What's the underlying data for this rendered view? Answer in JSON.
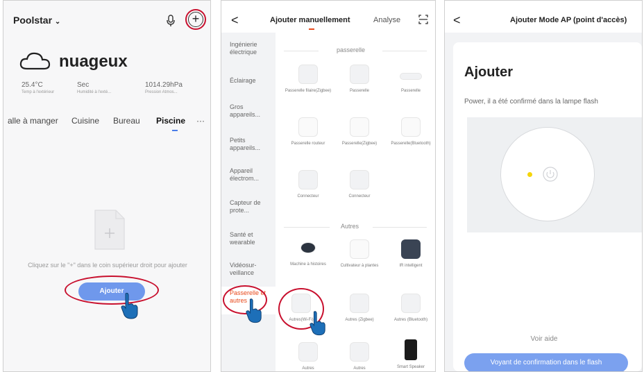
{
  "panel1": {
    "home_name": "Poolstar",
    "weather_label": "nuageux",
    "stats": [
      {
        "value": "25.4°C",
        "label": "Temp à l'extérieur"
      },
      {
        "value": "Sec",
        "label": "Humidité à l'exté..."
      },
      {
        "value": "1014.29hPa",
        "label": "Pression Atmos..."
      }
    ],
    "rooms": [
      "alle à manger",
      "Cuisine",
      "Bureau",
      "Piscine",
      "···"
    ],
    "empty_text": "Cliquez sur le \"+\" dans le coin supérieur droit pour ajouter",
    "add_button": "Ajouter",
    "plus_glyph": "+",
    "accent_color": "#6f98ec",
    "annotation_color": "#c8102e"
  },
  "panel2": {
    "back": "<",
    "title": "Ajouter manuellement",
    "scan_label": "Analyse",
    "sidebar": [
      "Ingénierie électrique",
      "Éclairage",
      "Gros appareils...",
      "Petits appareils...",
      "Appareil électrom...",
      "Capteur de prote...",
      "Santé et wearable",
      "Vidéosur-veillance",
      "Passerelle et autres"
    ],
    "section_gateway": "passerelle",
    "section_other": "Autres",
    "devices": [
      "Passerelle filaire(Zigbee)",
      "Passerelle",
      "Passerelle",
      "Passerelle routeur",
      "Passerelle(Zigbee)",
      "Passerelle(Bluetooth)",
      "Connecteur",
      "Connecteur",
      "Machine à histoires",
      "Cultivateur à plantes",
      "IR intelligent",
      "Autres(Wi-Fi)",
      "Autres (Zigbee)",
      "Autres (Bluetooth)",
      "Autres",
      "Autres",
      "Smart Speaker"
    ],
    "active_color": "#e84a1c"
  },
  "panel3": {
    "back": "<",
    "title": "Ajouter  Mode AP (point d'accès)",
    "card_title": "Ajouter",
    "card_desc": "Power, il a été confirmé dans la lampe flash",
    "help": "Voir aide",
    "confirm_button": "Voyant de confirmation dans le flash",
    "led_color": "#f5d50a"
  }
}
